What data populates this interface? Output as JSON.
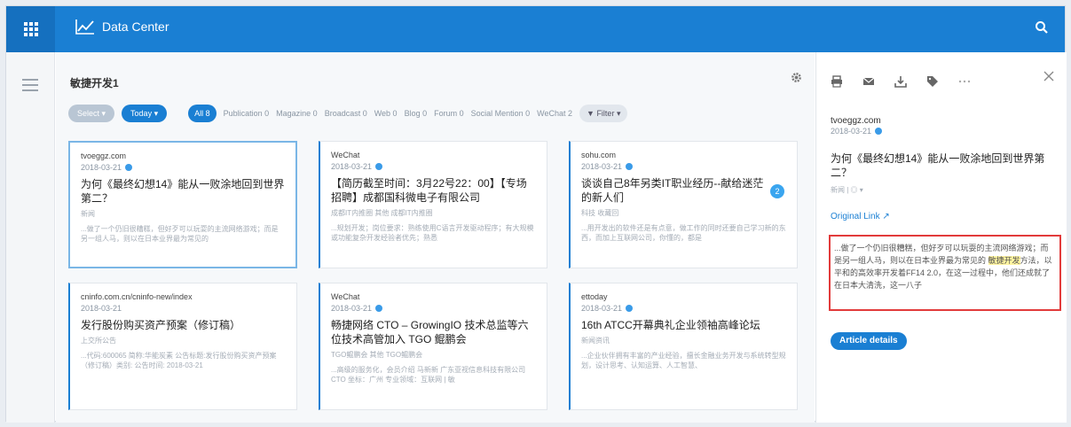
{
  "app": {
    "title": "Data Center"
  },
  "project": {
    "title": "敏捷开发1"
  },
  "filters": {
    "select_label": "Select ▾",
    "today_label": "Today ▾",
    "all_label": "All 8",
    "publication": "Publication 0",
    "magazine": "Magazine 0",
    "broadcast": "Broadcast 0",
    "web": "Web 0",
    "blog": "Blog 0",
    "forum": "Forum 0",
    "social": "Social Mention 0",
    "wechat": "WeChat 2",
    "filter_label": "▼ Filter ▾"
  },
  "cards": [
    {
      "source": "tvoeggz.com",
      "date": "2018-03-21",
      "title": "为何《最终幻想14》能从一败涂地回到世界第二？",
      "meta": "新闻",
      "snippet": "...做了一个仍旧很糟糕，但好歹可以玩耍的主流网络游戏；而是另一组人马，则以在日本业界最为常见的"
    },
    {
      "source": "WeChat",
      "date": "2018-03-21",
      "title": "【简历截至时间：3月22号22：00】【专场招聘】成都国科微电子有限公司",
      "meta": "成都IT内推圈 其他 成都IT内推圈",
      "snippet": "...规划开发；岗位要求：熟练使用C语言开发驱动程序；有大规模或功能复杂开发经验者优先；熟悉"
    },
    {
      "source": "sohu.com",
      "date": "2018-03-21",
      "title": "谈谈自己8年另类IT职业经历--献给迷茫的新人们",
      "meta": "科技 收藏回",
      "snippet": "...用开发出的软件还是有点意，做工作的同时还要自己学习新的东西，而加上互联网公司，你懂的，都是",
      "badge": "2"
    },
    {
      "source": "cninfo.com.cn/cninfo-new/index",
      "date": "2018-03-21",
      "title": "发行股份购买资产预案（修订稿）",
      "meta": "上交所公告",
      "snippet": "...代码:600065 简称:华能炭素 公告标题:发行股份购买资产预案（修订稿）类别: 公告时间: 2018-03-21"
    },
    {
      "source": "WeChat",
      "date": "2018-03-21",
      "title": "畅捷网络 CTO – GrowingIO 技术总监等六位技术高管加入 TGO 鲲鹏会",
      "meta": "TGO鲲鹏会 其他 TGO鲲鹏会",
      "snippet": "...高级的服务化，会员介绍 马新新 广东亚视信息科技有限公司 CTO 坐标：广州 专业领域：互联网 | 敏"
    },
    {
      "source": "ettoday",
      "date": "2018-03-21",
      "title": "16th ATCC开幕典礼企业领袖高峰论坛",
      "meta": "新闻资讯",
      "snippet": "...企业伙伴拥有丰富的产业经验，擅长金融业务开发与系统转型规划，设计思考、认知运算、人工智慧、"
    }
  ],
  "detail": {
    "source": "tvoeggz.com",
    "date": "2018-03-21",
    "title": "为何《最终幻想14》能从一败涂地回到世界第二？",
    "meta": "新闻 | ◎ ▾",
    "link": "Original Link ↗",
    "excerpt_pre": "...做了一个仍旧很糟糕，但好歹可以玩耍的主流网络游戏；而是另一组人马，则以在日本业界最为常见的 ",
    "excerpt_hl": "敏捷开发",
    "excerpt_post": "方法，以平和的高效率开发着FF14 2.0，在这一过程中，他们还成就了在日本大清洗，这一八子",
    "button": "Article details"
  },
  "colors": {
    "brand": "#1a7fd3",
    "highlight_box": "#e23b3b"
  }
}
